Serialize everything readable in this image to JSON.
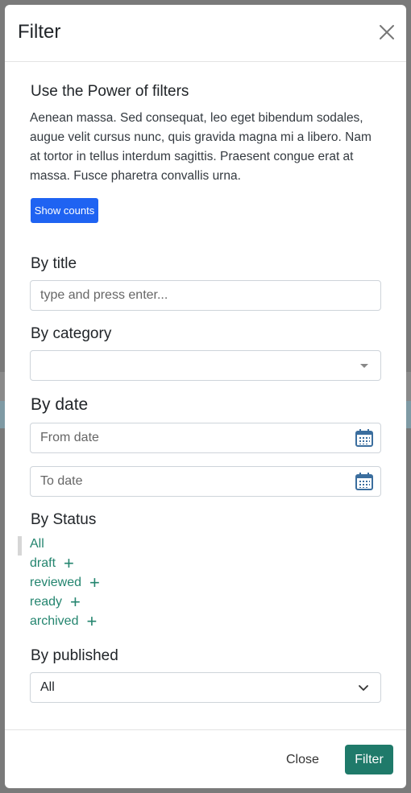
{
  "modal": {
    "title": "Filter",
    "intro_title": "Use the Power of filters",
    "intro_text": "Aenean massa. Sed consequat, leo eget bibendum sodales, augue velit cursus nunc, quis gravida magna mi a libero. Nam at tortor in tellus interdum sagittis. Praesent congue erat at massa. Fusce pharetra convallis urna.",
    "show_counts_label": "Show counts"
  },
  "filters": {
    "title_label": "By title",
    "title_placeholder": "type and press enter...",
    "category_label": "By category",
    "category_value": "",
    "date_label": "By date",
    "from_placeholder": "From date",
    "to_placeholder": "To date",
    "status_label": "By Status",
    "statuses": [
      "All",
      "draft",
      "reviewed",
      "ready",
      "archived"
    ],
    "published_label": "By published",
    "published_value": "All"
  },
  "footer": {
    "close_label": "Close",
    "filter_label": "Filter"
  },
  "colors": {
    "accent": "#1f7a6a",
    "link": "#24856f",
    "primary_button": "#1f63f2"
  },
  "icons": {
    "close": "close-icon",
    "calendar": "calendar-icon",
    "dropdown": "chevron-down-icon",
    "add": "plus-icon"
  }
}
